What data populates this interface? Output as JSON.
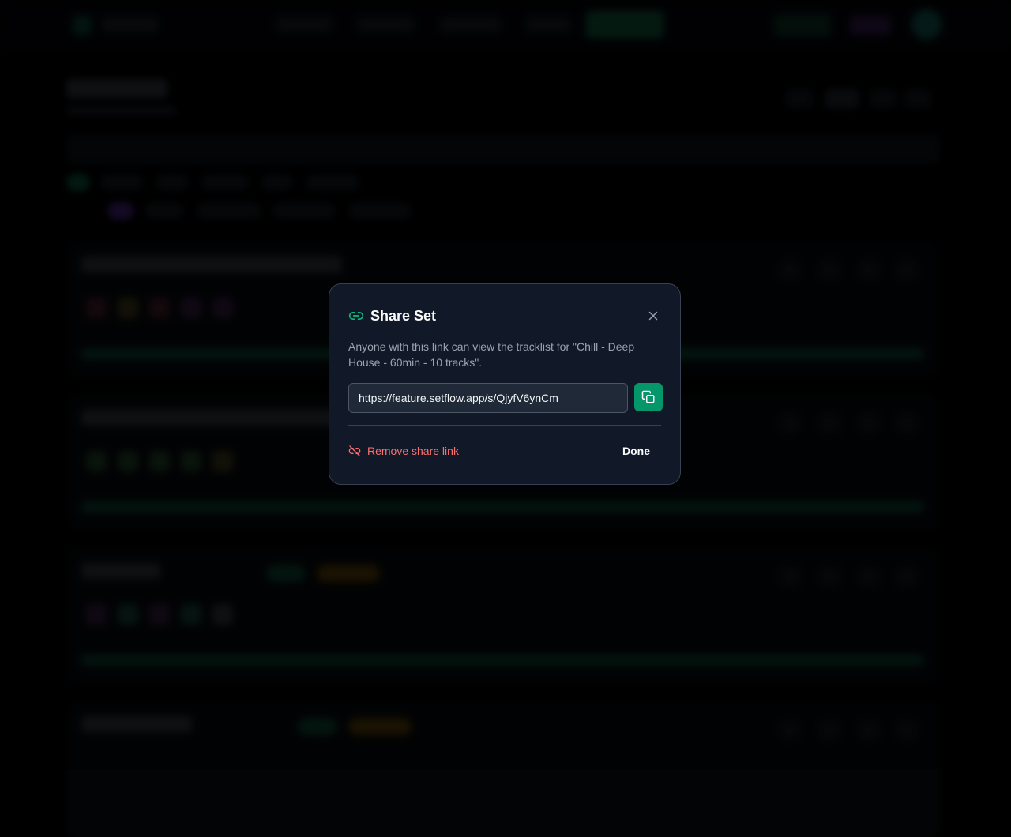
{
  "modal": {
    "title": "Share Set",
    "description": "Anyone with this link can view the tracklist for \"Chill - Deep House - 60min - 10 tracks\".",
    "share_url": "https://feature.setflow.app/s/QjyfV6ynCm",
    "remove_label": "Remove share link",
    "done_label": "Done",
    "icons": {
      "title": "link-icon",
      "close": "close-icon",
      "copy": "copy-icon",
      "remove": "unlink-icon"
    },
    "colors": {
      "accent": "#10b981",
      "copy_button": "#059669",
      "danger": "#f87171",
      "surface": "#111827"
    }
  }
}
